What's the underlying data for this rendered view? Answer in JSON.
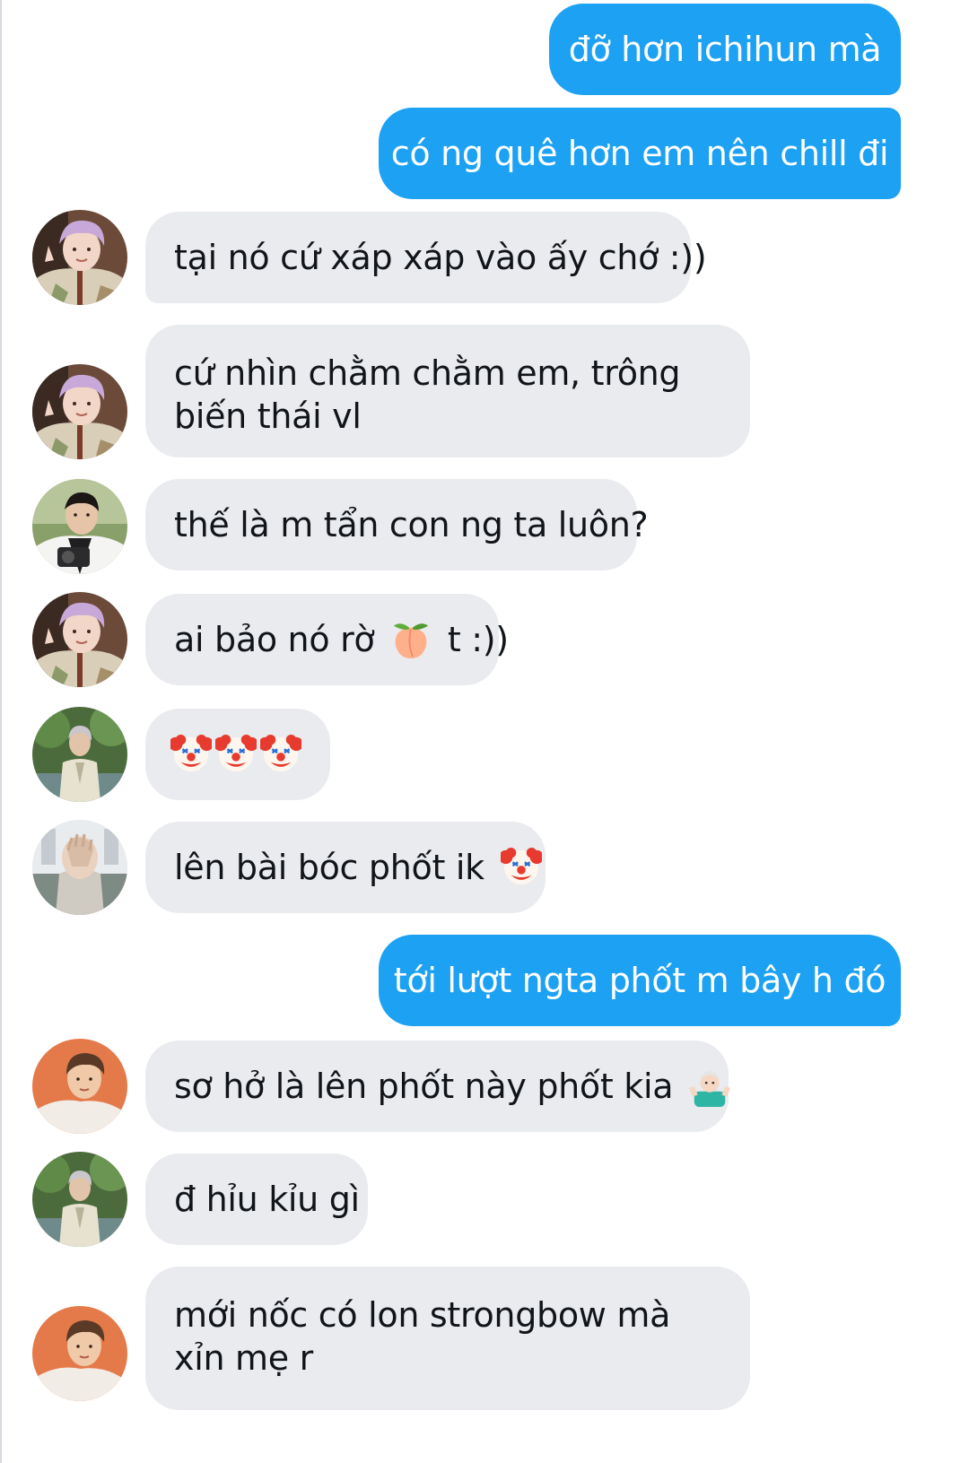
{
  "messages": [
    {
      "id": 1,
      "side": "out",
      "text": "đỡ hơn ichihun mà"
    },
    {
      "id": 2,
      "side": "out",
      "text": "có ng quê hơn em nên chill đi"
    },
    {
      "id": 3,
      "side": "in",
      "avatar": "avatar-lavender-hair-peace-sign",
      "text": "tại nó cứ xáp xáp vào ấy chớ :))"
    },
    {
      "id": 4,
      "side": "in",
      "avatar": "avatar-lavender-hair-peace-sign",
      "text": "cứ nhìn chằm chằm em, trông biến thái vl"
    },
    {
      "id": 5,
      "side": "in",
      "avatar": "avatar-dark-hair-camera",
      "text": "thế là m tẩn con ng ta luôn?"
    },
    {
      "id": 6,
      "side": "in",
      "avatar": "avatar-lavender-hair-peace-sign",
      "text_before": "ai bảo nó rờ ",
      "emoji": "peach-emoji",
      "text_after": " t :))"
    },
    {
      "id": 7,
      "side": "in",
      "avatar": "avatar-white-suit-garden",
      "emoji": "clown-face-emoji",
      "emoji_count": 3
    },
    {
      "id": 8,
      "side": "in",
      "avatar": "avatar-hand-over-face",
      "text_before": "lên bài bóc phốt ik ",
      "emoji": "clown-face-emoji"
    },
    {
      "id": 9,
      "side": "out",
      "text": "tới lượt ngta phốt m bây h đó"
    },
    {
      "id": 10,
      "side": "in",
      "avatar": "avatar-orange-background",
      "text_before": "sơ hở là lên phốt này phốt kia ",
      "emoji": "man-shrugging-emoji"
    },
    {
      "id": 11,
      "side": "in",
      "avatar": "avatar-white-suit-garden",
      "text": "đ hỉu kỉu gì"
    },
    {
      "id": 12,
      "side": "in",
      "avatar": "avatar-orange-background",
      "text": "mới nốc có lon strongbow mà xỉn mẹ r"
    }
  ],
  "colors": {
    "outgoing_bubble": "#1da1f2",
    "outgoing_text": "#ffffff",
    "incoming_bubble": "#e9ebef",
    "incoming_text": "#111418",
    "background": "#ffffff"
  }
}
